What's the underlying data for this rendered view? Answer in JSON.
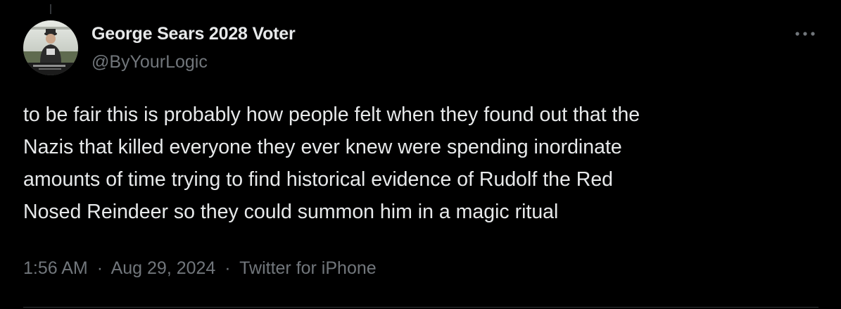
{
  "tweet": {
    "author": {
      "display_name": "George Sears 2028 Voter",
      "handle": "@ByYourLogic",
      "avatar_icon": "profile-photo-icon"
    },
    "more_icon": "more-dots-icon",
    "text_lines": [
      "to be fair this is probably how people felt when they found out that the",
      "Nazis that killed everyone they ever knew were spending inordinate",
      "amounts of time trying to find historical evidence of Rudolf the Red",
      "Nosed Reindeer so they could summon him in a magic ritual"
    ],
    "time": "1:56 AM",
    "separator": "·",
    "date": "Aug 29, 2024",
    "source": "Twitter for iPhone"
  },
  "colors": {
    "background": "#000000",
    "primary_text": "#e7e9ea",
    "secondary_text": "#71767b",
    "divider": "#2f3336"
  }
}
